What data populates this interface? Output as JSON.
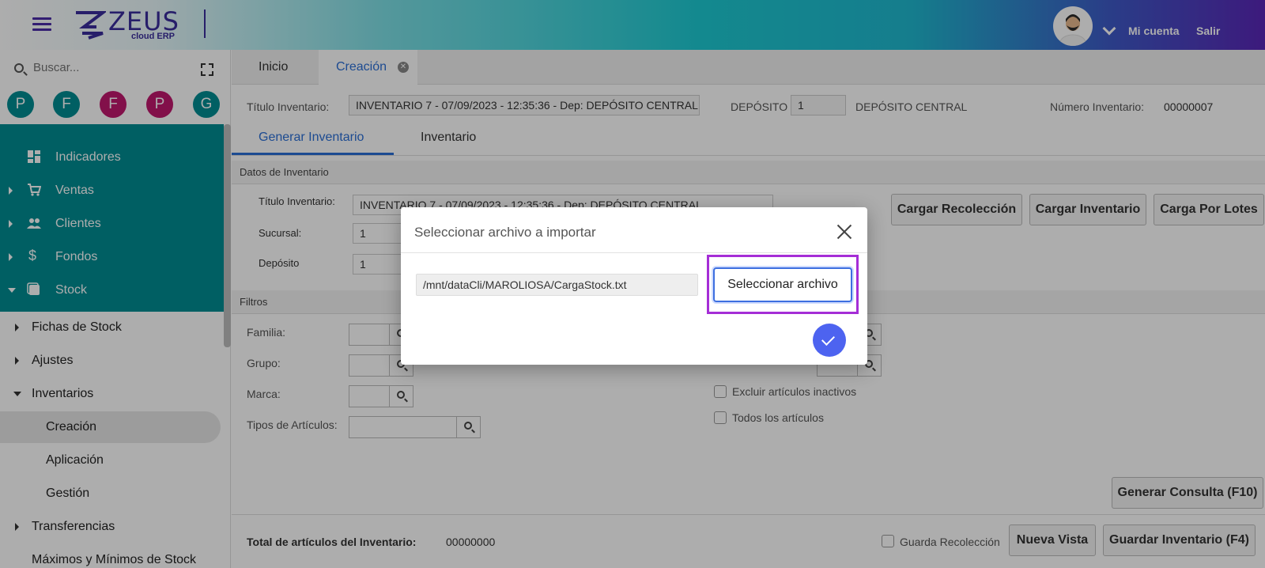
{
  "header": {
    "brand_name": "ZEUS",
    "brand_sub": "cloud ERP",
    "account_label": "Mi cuenta",
    "logout_label": "Salir"
  },
  "sidebar": {
    "search": {
      "placeholder": "Buscar..."
    },
    "favorites": [
      {
        "letter": "P",
        "color": "#008c93"
      },
      {
        "letter": "F",
        "color": "#008c93"
      },
      {
        "letter": "F",
        "color": "#c0186e"
      },
      {
        "letter": "P",
        "color": "#c0186e"
      },
      {
        "letter": "G",
        "color": "#008c93"
      }
    ],
    "menu": [
      {
        "label": "Indicadores",
        "icon": "dashboard-icon"
      },
      {
        "label": "Ventas",
        "icon": "cart-icon"
      },
      {
        "label": "Clientes",
        "icon": "people-icon"
      },
      {
        "label": "Fondos",
        "icon": "dollar-icon"
      },
      {
        "label": "Stock",
        "icon": "box-icon"
      }
    ],
    "submenu": [
      {
        "label": "Fichas de Stock"
      },
      {
        "label": "Ajustes"
      },
      {
        "label": "Inventarios"
      },
      {
        "label": "Creación"
      },
      {
        "label": "Aplicación"
      },
      {
        "label": "Gestión"
      },
      {
        "label": "Transferencias"
      },
      {
        "label": "Máximos y Mínimos de Stock"
      }
    ]
  },
  "tabs": [
    {
      "label": "Inicio"
    },
    {
      "label": "Creación"
    }
  ],
  "inventory_header": {
    "title_label": "Título Inventario:",
    "title_value": "INVENTARIO 7 - 07/09/2023 - 12:35:36 - Dep: DEPÓSITO CENTRAL",
    "deposit_label": "DEPÓSITO",
    "deposit_code": "1",
    "deposit_name": "DEPÓSITO CENTRAL",
    "number_label": "Número Inventario:",
    "number_value": "00000007"
  },
  "subtabs": [
    {
      "label": "Generar Inventario"
    },
    {
      "label": "Inventario"
    }
  ],
  "datos": {
    "section_title": "Datos de Inventario",
    "title_label": "Título Inventario:",
    "title_value": "INVENTARIO 7 - 07/09/2023 - 12:35:36 - Dep: DEPÓSITO CENTRAL",
    "sucursal_label": "Sucursal:",
    "sucursal_value": "1",
    "deposito_label": "Depósito",
    "deposito_value": "1",
    "btn_recoleccion": "Cargar Recolección",
    "btn_inventario": "Cargar Inventario",
    "btn_lotes": "Carga Por Lotes"
  },
  "filtros": {
    "section_title": "Filtros",
    "familia_label": "Familia:",
    "grupo_label": "Grupo:",
    "marca_label": "Marca:",
    "tipos_label": "Tipos de Artículos:",
    "excluir_label": "Excluir artículos inactivos",
    "todos_label": "Todos los artículos",
    "generar_label": "Generar Consulta (F10)"
  },
  "footer": {
    "total_label": "Total de artículos del Inventario:",
    "total_value": "00000000",
    "guarda_label": "Guarda Recolección",
    "nueva_vista_label": "Nueva Vista",
    "guardar_label": "Guardar Inventario (F4)"
  },
  "modal": {
    "title": "Seleccionar archivo a importar",
    "file_path": "/mnt/dataCli/MAROLIOSA/CargaStock.txt",
    "select_label": "Seleccionar archivo",
    "accent_color": "#4d63f0",
    "highlight_color": "#a52ed6"
  }
}
